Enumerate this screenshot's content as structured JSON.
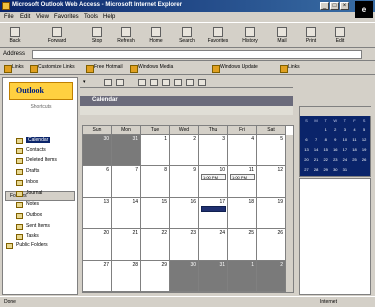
{
  "window": {
    "title": "Microsoft Outlook Web Access - Microsoft Internet Explorer"
  },
  "menu": [
    "File",
    "Edit",
    "View",
    "Favorites",
    "Tools",
    "Help"
  ],
  "toolbar": [
    "Back",
    "Forward",
    "Stop",
    "Refresh",
    "Home",
    "Search",
    "Favorites",
    "History",
    "Mail",
    "Print",
    "Edit"
  ],
  "address": {
    "label": "Address",
    "value": ""
  },
  "links": [
    "Links",
    "Customize Links",
    "Free Hotmail",
    "Windows Media",
    "Windows Update",
    "Links"
  ],
  "outlook_bar": {
    "logo": "Outlook",
    "shortcuts": "Shortcuts",
    "folders_title": "Folders",
    "folders": [
      "Calendar",
      "Contacts",
      "Deleted Items",
      "Drafts",
      "Inbox",
      "Journal",
      "Notes",
      "Outbox",
      "Sent Items",
      "Tasks",
      "Public Folders"
    ]
  },
  "calendar": {
    "banner": "Calendar",
    "month_label": "",
    "day_headers": [
      "Sun",
      "Mon",
      "Tue",
      "Wed",
      "Thu",
      "Fri",
      "Sat"
    ],
    "weeks": [
      [
        "30",
        "31",
        "1",
        "2",
        "3",
        "4",
        "5"
      ],
      [
        "6",
        "7",
        "8",
        "9",
        "10",
        "11",
        "12"
      ],
      [
        "13",
        "14",
        "15",
        "16",
        "17",
        "18",
        "19"
      ],
      [
        "20",
        "21",
        "22",
        "23",
        "24",
        "25",
        "26"
      ],
      [
        "27",
        "28",
        "29",
        "30",
        "31",
        "1",
        "2"
      ]
    ],
    "appointments": [
      {
        "text": "1:00 PM",
        "dark": false
      },
      {
        "text": "1:00 PM",
        "dark": false
      },
      {
        "text": "",
        "dark": true
      }
    ]
  },
  "mini_calendar": {
    "header": "",
    "day_initials": [
      "S",
      "M",
      "T",
      "W",
      "T",
      "F",
      "S"
    ],
    "rows": [
      [
        "",
        "",
        "1",
        "2",
        "3",
        "4",
        "5"
      ],
      [
        "6",
        "7",
        "8",
        "9",
        "10",
        "11",
        "12"
      ],
      [
        "13",
        "14",
        "15",
        "16",
        "17",
        "18",
        "19"
      ],
      [
        "20",
        "21",
        "22",
        "23",
        "24",
        "25",
        "26"
      ],
      [
        "27",
        "28",
        "29",
        "30",
        "31",
        "",
        ""
      ]
    ]
  },
  "status": {
    "left": "Done",
    "right": "Internet"
  }
}
